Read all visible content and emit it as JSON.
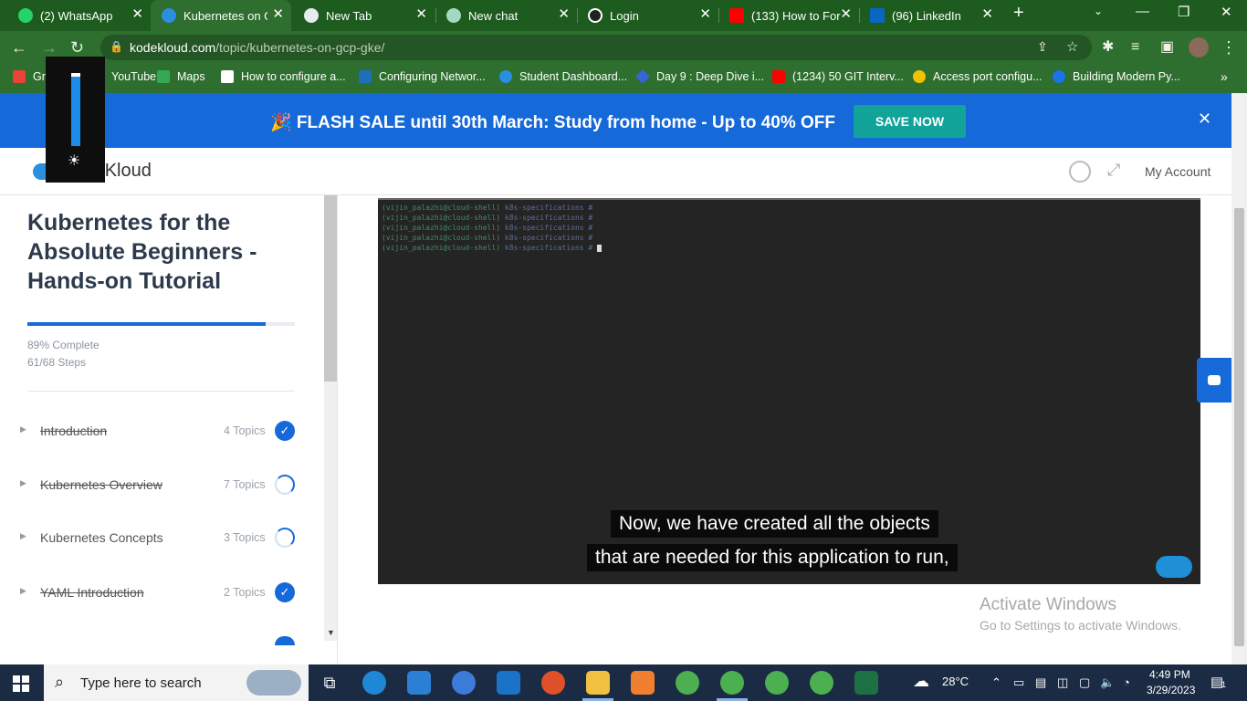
{
  "browser": {
    "tabs": [
      {
        "title": "(2) WhatsApp",
        "favicon": "whatsapp-icon",
        "color": "#25d366"
      },
      {
        "title": "Kubernetes on GCP",
        "favicon": "kodekloud-icon",
        "color": "#2a8fde",
        "active": true
      },
      {
        "title": "New Tab",
        "favicon": "chrome-icon",
        "color": "#e8eaed"
      },
      {
        "title": "New chat",
        "favicon": "chatgpt-icon",
        "color": "#a3d9c0"
      },
      {
        "title": "Login",
        "favicon": "login-icon",
        "color": "#222222"
      },
      {
        "title": "(133) How to For",
        "favicon": "youtube-icon",
        "color": "#ff0000"
      },
      {
        "title": "(96) LinkedIn",
        "favicon": "linkedin-icon",
        "color": "#0a66c2"
      }
    ],
    "new_tab": "+",
    "url_host": "kodekloud.com",
    "url_path": "/topic/kubernetes-on-gcp-gke/",
    "bookmarks": [
      {
        "label": "Gmail",
        "icon": "gmail-icon",
        "color": "#ea4335"
      },
      {
        "label": "YouTube",
        "icon": "youtube-icon",
        "color": "#ff0000"
      },
      {
        "label": "Maps",
        "icon": "maps-icon",
        "color": "#34a853"
      },
      {
        "label": "How to configure a...",
        "icon": "bookmark-icon",
        "color": "#ffffff"
      },
      {
        "label": "Configuring Networ...",
        "icon": "vmware-icon",
        "color": "#1d6fb8"
      },
      {
        "label": "Student Dashboard...",
        "icon": "kodekloud-icon",
        "color": "#2a8fde"
      },
      {
        "label": "Day 9 : Deep Dive i...",
        "icon": "diamond-icon",
        "color": "#3367d6"
      },
      {
        "label": "(1234) 50 GIT Interv...",
        "icon": "youtube-icon",
        "color": "#ff0000"
      },
      {
        "label": "Access port configu...",
        "icon": "cisco-icon",
        "color": "#f2c200"
      },
      {
        "label": "Building Modern Py...",
        "icon": "c-icon",
        "color": "#1a73e8"
      }
    ]
  },
  "banner": {
    "text": "🎉 FLASH SALE until 30th March: Study from home - Up to 40% OFF",
    "cta": "SAVE NOW",
    "close": "✕"
  },
  "header": {
    "logo": "KodeKloud",
    "account": "My Account"
  },
  "sidebar": {
    "course_title": "Kubernetes for the Absolute Beginners - Hands-on Tutorial",
    "progress_percent": 89,
    "progress_label": "89% Complete",
    "steps_label": "61/68 Steps",
    "lessons": [
      {
        "name": "Introduction",
        "topics": "4 Topics",
        "status": "complete",
        "done": true
      },
      {
        "name": "Kubernetes Overview",
        "topics": "7 Topics",
        "status": "partial",
        "done": true
      },
      {
        "name": "Kubernetes Concepts",
        "topics": "3 Topics",
        "status": "partial",
        "done": false
      },
      {
        "name": "YAML Introduction",
        "topics": "2 Topics",
        "status": "complete",
        "done": true
      }
    ]
  },
  "video": {
    "terminal_user": "(vijin_palazhi@cloud-shell)",
    "terminal_dir": "k8s-specifications #",
    "caption_line1": "Now, we have created all the objects",
    "caption_line2": "that are needed for this application to run,"
  },
  "watermark": {
    "line1": "Activate Windows",
    "line2": "Go to Settings to activate Windows."
  },
  "taskbar": {
    "search_placeholder": "Type here to search",
    "temperature": "28°C",
    "time": "4:49 PM",
    "date": "3/29/2023",
    "notification_count": "1"
  }
}
